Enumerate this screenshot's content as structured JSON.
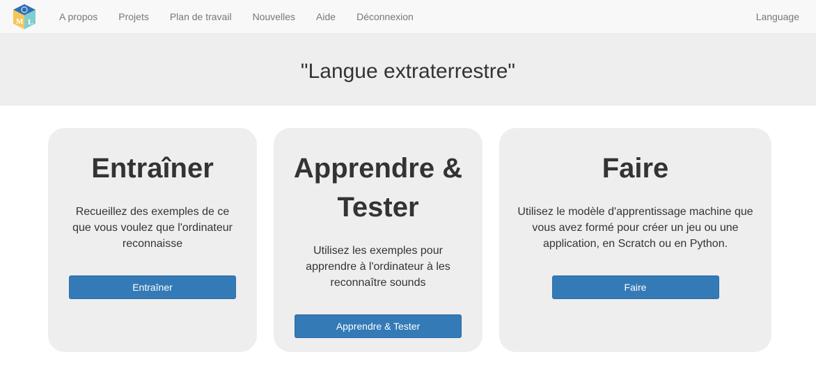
{
  "nav": {
    "items": [
      "A propos",
      "Projets",
      "Plan de travail",
      "Nouvelles",
      "Aide",
      "Déconnexion"
    ],
    "language": "Language"
  },
  "header": {
    "title": "\"Langue extraterrestre\""
  },
  "cards": [
    {
      "title": "Entraîner",
      "description": "Recueillez des exemples de ce que vous voulez que l'ordinateur reconnaisse",
      "button": "Entraîner"
    },
    {
      "title": "Apprendre & Tester",
      "description": "Utilisez les exemples pour apprendre à l'ordinateur à les reconnaître sounds",
      "button": "Apprendre & Tester"
    },
    {
      "title": "Faire",
      "description": "Utilisez le modèle d'apprentissage machine que vous avez formé pour créer un jeu ou une application, en Scratch ou en Python.",
      "button": "Faire"
    }
  ],
  "colors": {
    "primary": "#337ab7",
    "card_bg": "#eeeeee",
    "nav_bg": "#f8f8f8",
    "logo_yellow": "#f6c65b",
    "logo_blue": "#2f6fb5",
    "logo_teal": "#7fcfd0"
  }
}
